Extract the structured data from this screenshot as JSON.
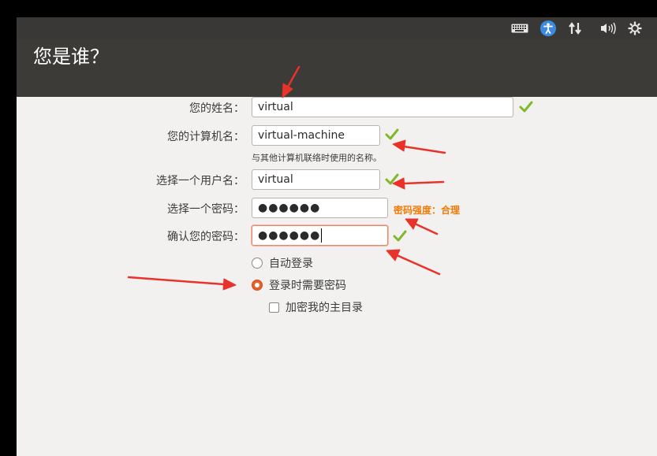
{
  "header": {
    "title": "您是谁？"
  },
  "tray": {
    "icons": [
      "keyboard-icon",
      "accessibility-icon",
      "network-icon",
      "volume-icon",
      "settings-icon"
    ]
  },
  "form": {
    "name_label": "您的姓名：",
    "name_value": "virtual",
    "computer_label": "您的计算机名：",
    "computer_value": "virtual-machine",
    "computer_hint": "与其他计算机联络时使用的名称。",
    "username_label": "选择一个用户名：",
    "username_value": "virtual",
    "password_label": "选择一个密码：",
    "password_value": "●●●●●●",
    "password_strength": "密码强度：合理",
    "confirm_label": "确认您的密码：",
    "confirm_value": "●●●●●●"
  },
  "login_options": {
    "auto_login": "自动登录",
    "require_password": "登录时需要密码",
    "encrypt_home": "加密我的主目录",
    "selected": "require_password",
    "encrypt_checked": false
  },
  "colors": {
    "check": "#7fb82a",
    "strength": "#f07b08",
    "accent": "#e5612e",
    "annotation_arrow": "#e8322a"
  }
}
